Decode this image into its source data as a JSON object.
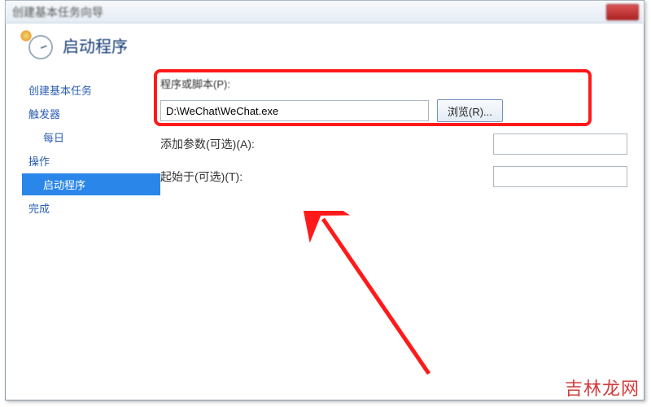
{
  "window": {
    "title": "创建基本任务向导"
  },
  "header": {
    "title": "启动程序"
  },
  "sidebar": {
    "items": [
      {
        "label": "创建基本任务",
        "indent": false,
        "selected": false
      },
      {
        "label": "触发器",
        "indent": false,
        "selected": false
      },
      {
        "label": "每日",
        "indent": true,
        "selected": false
      },
      {
        "label": "操作",
        "indent": false,
        "selected": false
      },
      {
        "label": "启动程序",
        "indent": true,
        "selected": true
      },
      {
        "label": "完成",
        "indent": false,
        "selected": false
      }
    ]
  },
  "form": {
    "program_label": "程序或脚本(P):",
    "program_value": "D:\\WeChat\\WeChat.exe",
    "browse_label": "浏览(R)...",
    "args_label": "添加参数(可选)(A):",
    "args_value": "",
    "startin_label": "起始于(可选)(T):",
    "startin_value": ""
  },
  "watermark": "吉林龙网"
}
